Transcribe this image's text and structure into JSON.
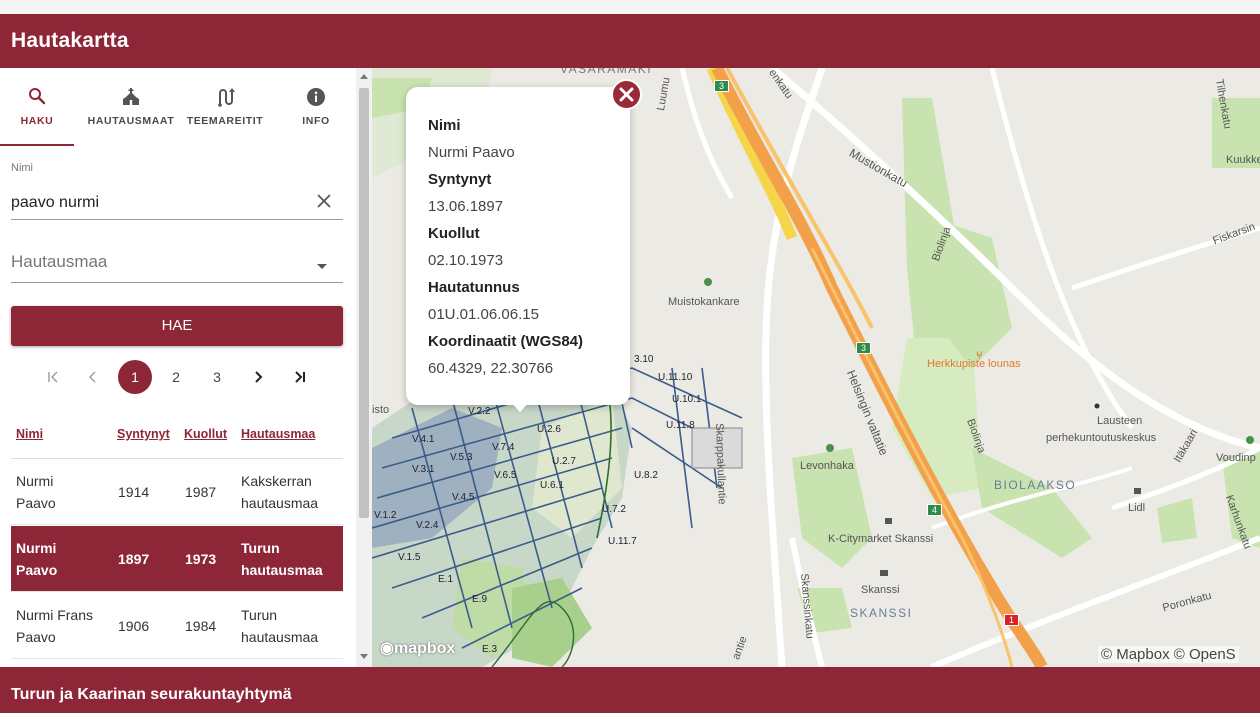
{
  "app": {
    "title": "Hautakartta"
  },
  "tabs": [
    {
      "label": "HAKU",
      "icon": "search-icon"
    },
    {
      "label": "HAUTAUSMAAT",
      "icon": "church-icon"
    },
    {
      "label": "TEEMAREITIT",
      "icon": "route-icon"
    },
    {
      "label": "INFO",
      "icon": "info-icon"
    }
  ],
  "search": {
    "name_label": "Nimi",
    "name_value": "paavo nurmi",
    "cemetery_value": "Hautausmaa",
    "button_label": "HAE"
  },
  "pagination": {
    "pages": [
      "1",
      "2",
      "3"
    ],
    "current": "1"
  },
  "results": {
    "headers": [
      "Nimi",
      "Syntynyt",
      "Kuollut",
      "Hautausmaa"
    ],
    "rows": [
      {
        "name": [
          "Nurmi",
          "Paavo"
        ],
        "born": "1914",
        "died": "1987",
        "cemetery": [
          "Kakskerran",
          "hautausmaa"
        ]
      },
      {
        "name": [
          "Nurmi",
          "Paavo"
        ],
        "born": "1897",
        "died": "1973",
        "cemetery": [
          "Turun",
          "hautausmaa"
        ]
      },
      {
        "name": [
          "Nurmi Frans",
          "Paavo"
        ],
        "born": "1906",
        "died": "1984",
        "cemetery": [
          "Turun",
          "hautausmaa"
        ]
      }
    ]
  },
  "popup": {
    "name_label": "Nimi",
    "name": "Nurmi Paavo",
    "born_label": "Syntynyt",
    "born": "13.06.1897",
    "died_label": "Kuollut",
    "died": "02.10.1973",
    "grave_label": "Hautatunnus",
    "grave": "01U.01.06.06.15",
    "coord_label": "Koordinaatit (WGS84)",
    "coords": "60.4329, 22.30766"
  },
  "map": {
    "labels": {
      "vasaramaki": "VASARAMÄKI",
      "mustionkatu": "Mustionkatu",
      "biolinja1": "Biolinja",
      "biolinja2": "Biolinja",
      "fiskarsin": "Fiskarsin",
      "kuukkeli": "Kuukkeli",
      "tilhenkatu": "Tilhenkatu",
      "muistokankare": "Muistokankare",
      "herkkupiste": "Herkkupiste lounas",
      "lausteen": "Lausteen",
      "perhekuntoutus": "perhekuntoutuskeskus",
      "voudinp": "Voudinp",
      "itakaari": "Itäkaari",
      "karhunkatu": "Karhunkatu",
      "biolaakso": "BIOLAAKSO",
      "lidl": "Lidl",
      "levonhaka": "Levonhaka",
      "kcitymarket": "K-Citymarket Skanssi",
      "skanssi": "Skanssi",
      "skanssi_area": "SKANSSI",
      "poronkatu": "Poronkatu",
      "skarppakullantie": "Skarppakullantie",
      "skanssinkatu": "Skanssinkatu",
      "helsingin": "Helsingin valtatie",
      "luumu": "Luumu",
      "kenkatu": "enkatu",
      "isto": "isto",
      "antie": "antie"
    },
    "road_shields": [
      "3",
      "3",
      "4",
      "1"
    ],
    "plots": [
      "V.2.2",
      "V.4.1",
      "V.3.1",
      "V.5.3",
      "V.7.4",
      "V.6.5",
      "V.4.5",
      "V.1.2",
      "V.2.4",
      "V.1.5",
      "U.2.6",
      "U.2.7",
      "U.6.1",
      "U.7.2",
      "U.11.8",
      "U.11.10",
      "U.10.1",
      "U.8.2",
      "U.11.7",
      "E.9",
      "E.1",
      "E.3",
      "3.10"
    ],
    "attribution": "© Mapbox © OpenS",
    "logo": "mapbox"
  },
  "footer": {
    "text": "Turun ja Kaarinan seurakuntayhtymä"
  },
  "colors": {
    "brand": "#8d2637",
    "park": "#c9e3b0",
    "highway": "#f2a04a",
    "cemetery_paths": "#3b5c8a"
  }
}
